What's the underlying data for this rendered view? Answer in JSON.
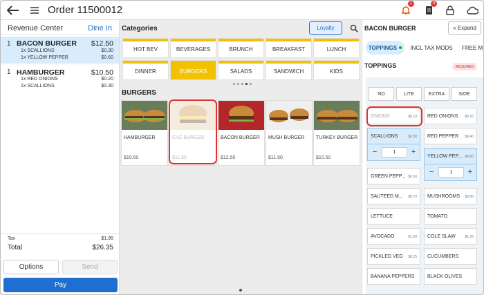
{
  "header": {
    "title": "Order 11500012",
    "notif_count": "1",
    "receipt_count": "4"
  },
  "left": {
    "revenue_label": "Revenue Center",
    "revenue_value": "Dine In",
    "items": [
      {
        "num": "1",
        "name": "BACON BURGER",
        "price": "$12.50",
        "mods": [
          {
            "label": "1x SCALLIONS",
            "price": "$0.30"
          },
          {
            "label": "1x YELLOW PEPPER",
            "price": "$0.60"
          }
        ]
      },
      {
        "num": "1",
        "name": "HAMBURGER",
        "price": "$10.50",
        "mods": [
          {
            "label": "1x RED ONIONS",
            "price": "$0.20"
          },
          {
            "label": "1x SCALLIONS",
            "price": "$0.30"
          }
        ]
      }
    ],
    "tax_label": "Tax",
    "tax_value": "$1.95",
    "total_label": "Total",
    "total_value": "$26.35",
    "options_label": "Options",
    "send_label": "Send",
    "pay_label": "Pay"
  },
  "center": {
    "categories_label": "Categories",
    "loyalty_label": "Loyalty",
    "categories": [
      "HOT BEV",
      "BEVERAGES",
      "BRUNCH",
      "BREAKFAST",
      "LUNCH",
      "DINNER",
      "BURGERS",
      "SALADS",
      "SANDWICH",
      "KIDS"
    ],
    "selected_category": "BURGERS",
    "section": "BURGERS",
    "products": [
      {
        "name": "HAMBURGER",
        "price": "$10.50"
      },
      {
        "name": "CHZ BURGER",
        "price": "$11.50"
      },
      {
        "name": "BACON BURGER",
        "price": "$12.50"
      },
      {
        "name": "MUSH BURGER",
        "price": "$11.50"
      },
      {
        "name": "TURKEY BURGER",
        "price": "$10.50"
      }
    ]
  },
  "right": {
    "title": "BACON BURGER",
    "expand_label": "« Expand",
    "tabs": [
      "TOPPINGS",
      "INCL TAX MODS",
      "FREE M"
    ],
    "toppings_label": "TOPPINGS",
    "required_label": "REQUIRED",
    "options": [
      "NO",
      "LITE",
      "EXTRA",
      "SIDE"
    ],
    "toppings": [
      {
        "name": "ONIONS",
        "price": "$0.10"
      },
      {
        "name": "RED ONIONS",
        "price": "$0.20"
      },
      {
        "name": "SCALLIONS",
        "price": "$0.30"
      },
      {
        "name": "RED PEPPER",
        "price": "$0.40"
      },
      {
        "name": "YELLOW PEP...",
        "price": "$0.60"
      },
      {
        "name": "GREEN PEPP...",
        "price": "$0.50"
      },
      {
        "name": "MUSHROOMS",
        "price": "$0.80"
      },
      {
        "name": "SAUTEED M...",
        "price": "$0.70"
      },
      {
        "name": "TOMATO",
        "price": ""
      },
      {
        "name": "LETTUCE",
        "price": ""
      },
      {
        "name": "COLE SLAW",
        "price": "$1.25"
      },
      {
        "name": "AVOCADO",
        "price": "$1.50"
      },
      {
        "name": "CUCUMBERS",
        "price": ""
      },
      {
        "name": "PICKLED VEG",
        "price": "$0.25"
      },
      {
        "name": "BLACK OLIVES",
        "price": ""
      },
      {
        "name": "BANANA PEPPERS",
        "price": ""
      }
    ],
    "scallions_qty": "1",
    "yellow_qty": "1"
  }
}
